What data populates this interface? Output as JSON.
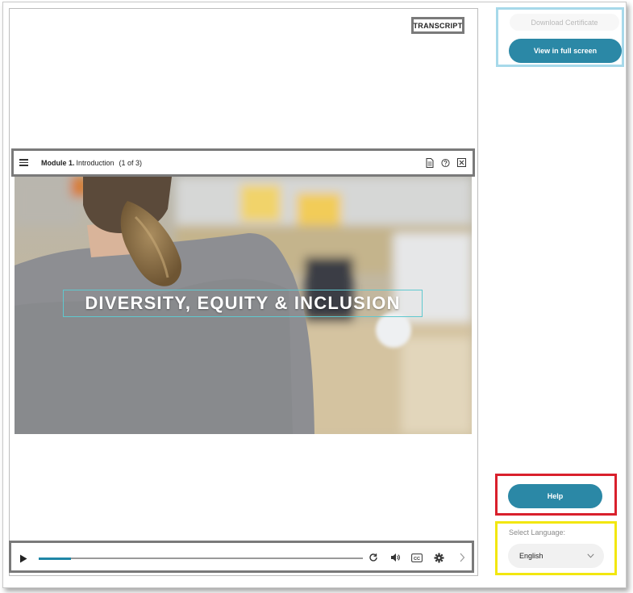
{
  "player": {
    "transcript_label": "TRANSCRIPT",
    "module": {
      "number_label": "Module 1.",
      "title": "Introduction",
      "count": "(1 of 3)"
    },
    "video_title": "DIVERSITY, EQUITY & INCLUSION",
    "progress": 0.1,
    "icons": {
      "menu": "hamburger-menu-icon",
      "document": "document-icon",
      "help": "question-icon",
      "close": "close-icon",
      "play": "play-icon",
      "replay": "replay-icon",
      "volume": "volume-icon",
      "captions": "closed-captions-icon",
      "settings": "gear-icon",
      "next": "chevron-right-icon"
    }
  },
  "sidebar": {
    "download_label": "Download Certificate",
    "fullscreen_label": "View in full screen",
    "help_label": "Help",
    "language_label": "Select Language:",
    "language_value": "English"
  },
  "colors": {
    "accent": "#2b88a6",
    "progress": "#1f86a6",
    "video_title_border": "#5fc8cf"
  }
}
